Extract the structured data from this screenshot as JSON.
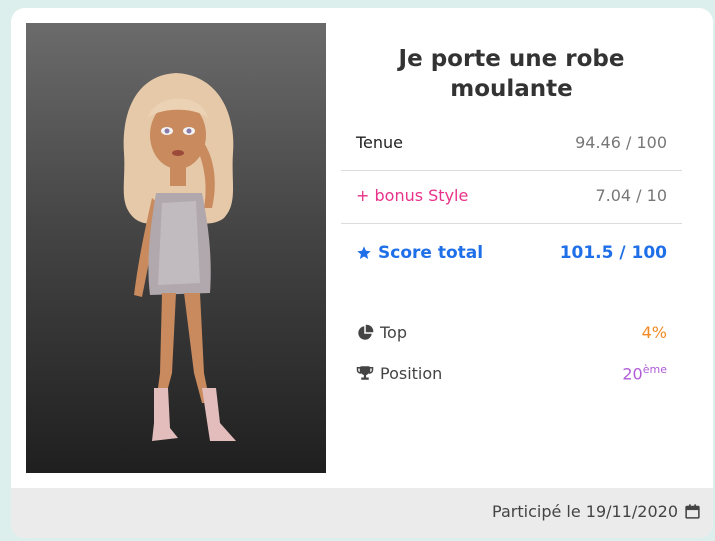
{
  "outfit": {
    "title": "Je porte une robe moulante"
  },
  "scores": {
    "tenue_label": "Tenue",
    "tenue_value": "94.46 / 100",
    "bonus_label": "+ bonus Style",
    "bonus_value": "7.04 / 10",
    "total_label": "Score total",
    "total_value": "101.5 / 100"
  },
  "ranking": {
    "top_label": "Top",
    "top_value": "4%",
    "position_label": "Position",
    "position_value": "20",
    "position_suffix": "ème"
  },
  "footer": {
    "participation": "Participé le 19/11/2020"
  },
  "icons": {
    "total": "star-icon",
    "top": "pie-chart-icon",
    "position": "trophy-icon",
    "date": "calendar-icon"
  },
  "colors": {
    "accent_blue": "#1f6fe8",
    "bonus_pink": "#e8338a",
    "top_orange": "#f08a24",
    "position_purple": "#b05cd8"
  }
}
